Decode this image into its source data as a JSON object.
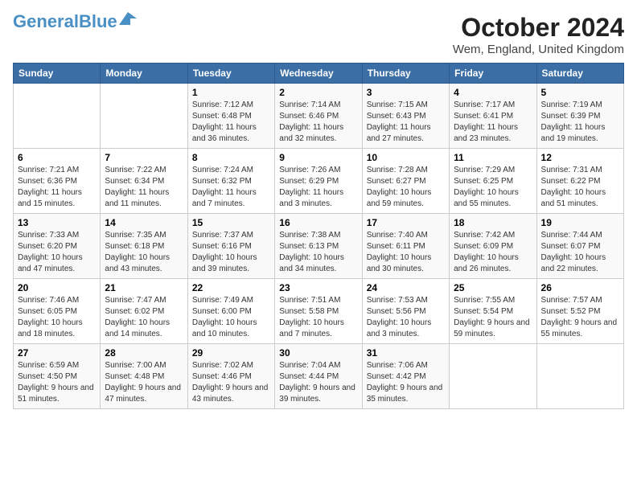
{
  "header": {
    "logo_general": "General",
    "logo_blue": "Blue",
    "month": "October 2024",
    "location": "Wem, England, United Kingdom"
  },
  "days_of_week": [
    "Sunday",
    "Monday",
    "Tuesday",
    "Wednesday",
    "Thursday",
    "Friday",
    "Saturday"
  ],
  "weeks": [
    [
      {
        "day": "",
        "info": ""
      },
      {
        "day": "",
        "info": ""
      },
      {
        "day": "1",
        "info": "Sunrise: 7:12 AM\nSunset: 6:48 PM\nDaylight: 11 hours and 36 minutes."
      },
      {
        "day": "2",
        "info": "Sunrise: 7:14 AM\nSunset: 6:46 PM\nDaylight: 11 hours and 32 minutes."
      },
      {
        "day": "3",
        "info": "Sunrise: 7:15 AM\nSunset: 6:43 PM\nDaylight: 11 hours and 27 minutes."
      },
      {
        "day": "4",
        "info": "Sunrise: 7:17 AM\nSunset: 6:41 PM\nDaylight: 11 hours and 23 minutes."
      },
      {
        "day": "5",
        "info": "Sunrise: 7:19 AM\nSunset: 6:39 PM\nDaylight: 11 hours and 19 minutes."
      }
    ],
    [
      {
        "day": "6",
        "info": "Sunrise: 7:21 AM\nSunset: 6:36 PM\nDaylight: 11 hours and 15 minutes."
      },
      {
        "day": "7",
        "info": "Sunrise: 7:22 AM\nSunset: 6:34 PM\nDaylight: 11 hours and 11 minutes."
      },
      {
        "day": "8",
        "info": "Sunrise: 7:24 AM\nSunset: 6:32 PM\nDaylight: 11 hours and 7 minutes."
      },
      {
        "day": "9",
        "info": "Sunrise: 7:26 AM\nSunset: 6:29 PM\nDaylight: 11 hours and 3 minutes."
      },
      {
        "day": "10",
        "info": "Sunrise: 7:28 AM\nSunset: 6:27 PM\nDaylight: 10 hours and 59 minutes."
      },
      {
        "day": "11",
        "info": "Sunrise: 7:29 AM\nSunset: 6:25 PM\nDaylight: 10 hours and 55 minutes."
      },
      {
        "day": "12",
        "info": "Sunrise: 7:31 AM\nSunset: 6:22 PM\nDaylight: 10 hours and 51 minutes."
      }
    ],
    [
      {
        "day": "13",
        "info": "Sunrise: 7:33 AM\nSunset: 6:20 PM\nDaylight: 10 hours and 47 minutes."
      },
      {
        "day": "14",
        "info": "Sunrise: 7:35 AM\nSunset: 6:18 PM\nDaylight: 10 hours and 43 minutes."
      },
      {
        "day": "15",
        "info": "Sunrise: 7:37 AM\nSunset: 6:16 PM\nDaylight: 10 hours and 39 minutes."
      },
      {
        "day": "16",
        "info": "Sunrise: 7:38 AM\nSunset: 6:13 PM\nDaylight: 10 hours and 34 minutes."
      },
      {
        "day": "17",
        "info": "Sunrise: 7:40 AM\nSunset: 6:11 PM\nDaylight: 10 hours and 30 minutes."
      },
      {
        "day": "18",
        "info": "Sunrise: 7:42 AM\nSunset: 6:09 PM\nDaylight: 10 hours and 26 minutes."
      },
      {
        "day": "19",
        "info": "Sunrise: 7:44 AM\nSunset: 6:07 PM\nDaylight: 10 hours and 22 minutes."
      }
    ],
    [
      {
        "day": "20",
        "info": "Sunrise: 7:46 AM\nSunset: 6:05 PM\nDaylight: 10 hours and 18 minutes."
      },
      {
        "day": "21",
        "info": "Sunrise: 7:47 AM\nSunset: 6:02 PM\nDaylight: 10 hours and 14 minutes."
      },
      {
        "day": "22",
        "info": "Sunrise: 7:49 AM\nSunset: 6:00 PM\nDaylight: 10 hours and 10 minutes."
      },
      {
        "day": "23",
        "info": "Sunrise: 7:51 AM\nSunset: 5:58 PM\nDaylight: 10 hours and 7 minutes."
      },
      {
        "day": "24",
        "info": "Sunrise: 7:53 AM\nSunset: 5:56 PM\nDaylight: 10 hours and 3 minutes."
      },
      {
        "day": "25",
        "info": "Sunrise: 7:55 AM\nSunset: 5:54 PM\nDaylight: 9 hours and 59 minutes."
      },
      {
        "day": "26",
        "info": "Sunrise: 7:57 AM\nSunset: 5:52 PM\nDaylight: 9 hours and 55 minutes."
      }
    ],
    [
      {
        "day": "27",
        "info": "Sunrise: 6:59 AM\nSunset: 4:50 PM\nDaylight: 9 hours and 51 minutes."
      },
      {
        "day": "28",
        "info": "Sunrise: 7:00 AM\nSunset: 4:48 PM\nDaylight: 9 hours and 47 minutes."
      },
      {
        "day": "29",
        "info": "Sunrise: 7:02 AM\nSunset: 4:46 PM\nDaylight: 9 hours and 43 minutes."
      },
      {
        "day": "30",
        "info": "Sunrise: 7:04 AM\nSunset: 4:44 PM\nDaylight: 9 hours and 39 minutes."
      },
      {
        "day": "31",
        "info": "Sunrise: 7:06 AM\nSunset: 4:42 PM\nDaylight: 9 hours and 35 minutes."
      },
      {
        "day": "",
        "info": ""
      },
      {
        "day": "",
        "info": ""
      }
    ]
  ]
}
